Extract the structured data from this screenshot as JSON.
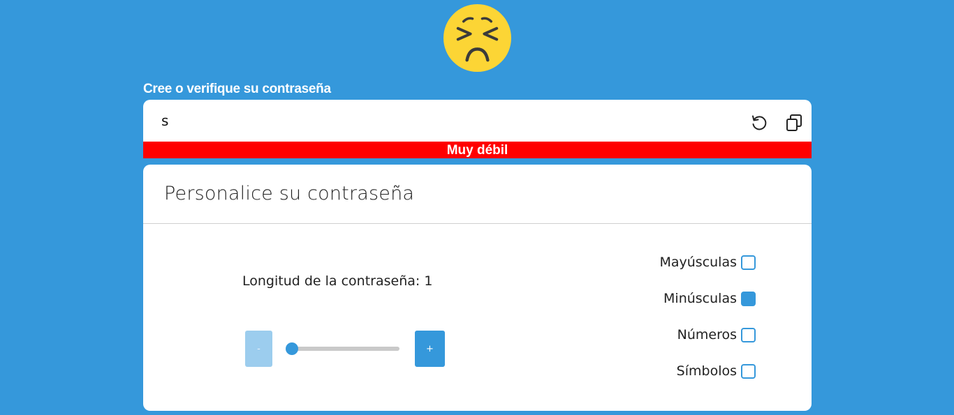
{
  "heading": "Cree o verifique su contraseña",
  "password": {
    "value": "s"
  },
  "strength": {
    "label": "Muy débil",
    "color": "#ff0000"
  },
  "customize": {
    "title": "Personalice su contraseña",
    "length_label": "Longitud de la contraseña: 1",
    "length": 1,
    "length_fraction": 0.0,
    "minus_label": "-",
    "plus_label": "+",
    "options": [
      {
        "label": "Mayúsculas",
        "checked": false
      },
      {
        "label": "Minúsculas",
        "checked": true
      },
      {
        "label": "Números",
        "checked": false
      },
      {
        "label": "Símbolos",
        "checked": false
      }
    ]
  },
  "icons": {
    "emoji": "persevering-face-icon",
    "refresh": "refresh-icon",
    "copy": "copy-icon"
  },
  "colors": {
    "background": "#3598db",
    "accent": "#3598db",
    "emoji_face": "#fcd535"
  }
}
